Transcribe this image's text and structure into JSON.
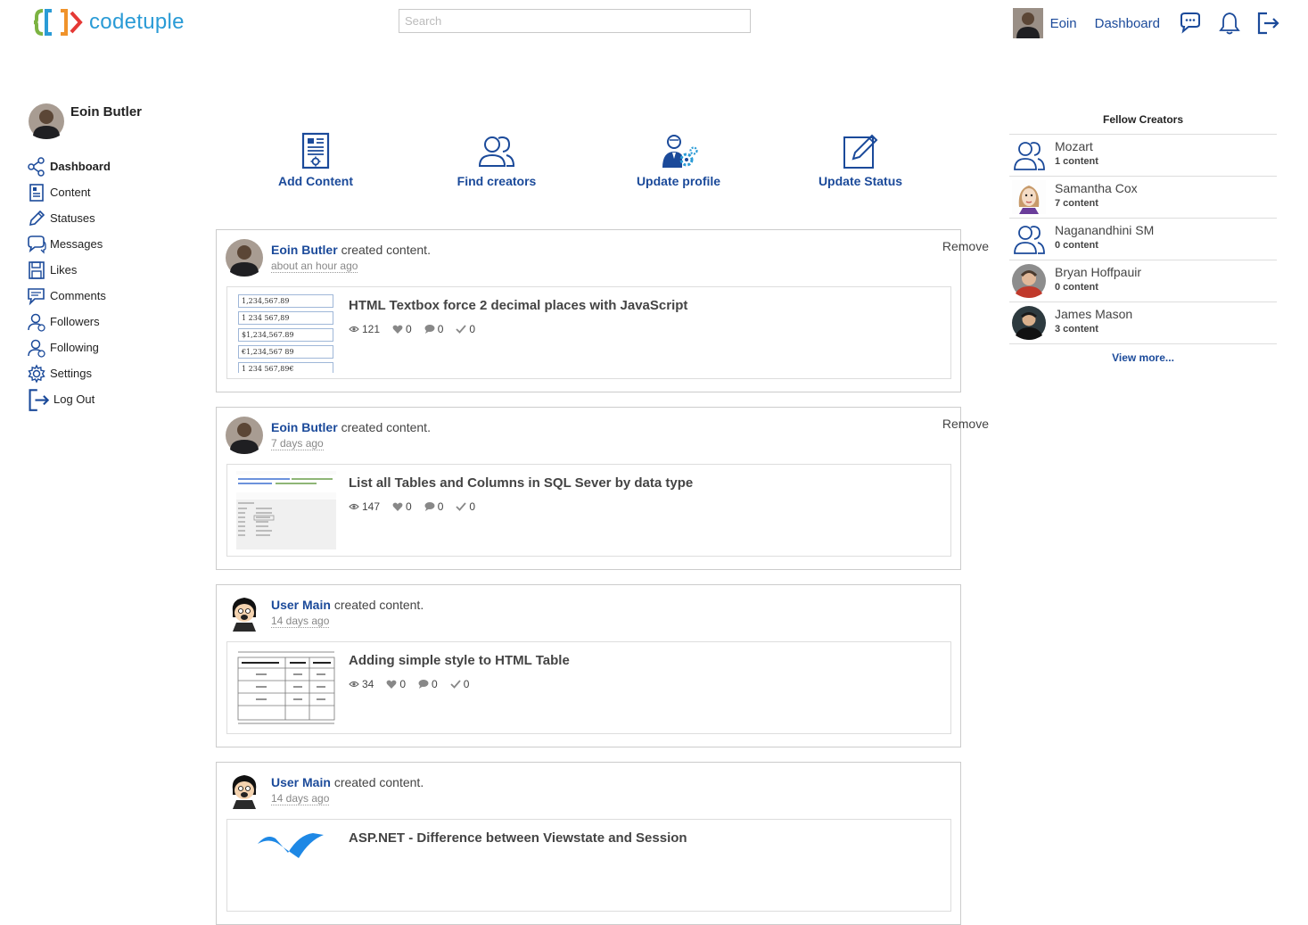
{
  "brand": {
    "name": "codetuple"
  },
  "search": {
    "placeholder": "Search"
  },
  "topnav": {
    "user": "Eoin",
    "dashboard": "Dashboard"
  },
  "profile": {
    "name": "Eoin Butler"
  },
  "sidebar": {
    "items": [
      {
        "label": "Dashboard",
        "icon": "share-icon"
      },
      {
        "label": "Content",
        "icon": "document-icon"
      },
      {
        "label": "Statuses",
        "icon": "pencil-icon"
      },
      {
        "label": "Messages",
        "icon": "chat-icon"
      },
      {
        "label": "Likes",
        "icon": "save-icon"
      },
      {
        "label": "Comments",
        "icon": "comment-icon"
      },
      {
        "label": "Followers",
        "icon": "user-icon"
      },
      {
        "label": "Following",
        "icon": "user-icon"
      },
      {
        "label": "Settings",
        "icon": "gear-icon"
      },
      {
        "label": "Log Out",
        "icon": "logout-icon"
      }
    ]
  },
  "actions": [
    {
      "label": "Add Content"
    },
    {
      "label": "Find creators"
    },
    {
      "label": "Update profile"
    },
    {
      "label": "Update Status"
    }
  ],
  "feed": [
    {
      "user": "Eoin Butler",
      "action": "created content.",
      "time": "about an hour ago",
      "remove": "Remove",
      "title": "HTML Textbox force 2 decimal places with JavaScript",
      "views": "121",
      "likes": "0",
      "comments": "0",
      "checks": "0",
      "thumb_lines": [
        "1,234,567.89",
        "1 234 567,89",
        "$1,234,567.89",
        "€1,234,567 89",
        "1 234 567,89€"
      ]
    },
    {
      "user": "Eoin Butler",
      "action": "created content.",
      "time": "7 days ago",
      "remove": "Remove",
      "title": "List all Tables and Columns in SQL Sever by data type",
      "views": "147",
      "likes": "0",
      "comments": "0",
      "checks": "0"
    },
    {
      "user": "User Main",
      "action": "created content.",
      "time": "14 days ago",
      "title": "Adding simple style to HTML Table",
      "views": "34",
      "likes": "0",
      "comments": "0",
      "checks": "0"
    },
    {
      "user": "User Main",
      "action": "created content.",
      "time": "14 days ago",
      "title": "ASP.NET - Difference between Viewstate and Session"
    }
  ],
  "fellow": {
    "title": "Fellow Creators",
    "creators": [
      {
        "name": "Mozart",
        "count": "1 content"
      },
      {
        "name": "Samantha Cox",
        "count": "7 content"
      },
      {
        "name": "Naganandhini SM",
        "count": "0 content"
      },
      {
        "name": "Bryan Hoffpauir",
        "count": "0 content"
      },
      {
        "name": "James Mason",
        "count": "3 content"
      }
    ],
    "more": "View more..."
  },
  "colors": {
    "brand_blue": "#1b4a9a",
    "logo_green": "#7cb342",
    "logo_blue": "#2a9bd6",
    "logo_orange": "#f0932b",
    "logo_red": "#e53935"
  }
}
